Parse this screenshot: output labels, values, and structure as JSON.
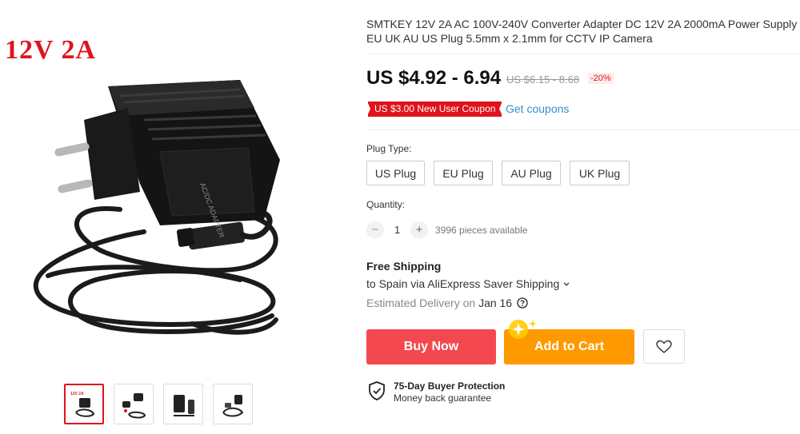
{
  "product": {
    "voltage_label": "12V 2A",
    "title": "SMTKEY 12V 2A AC 100V-240V Converter Adapter DC 12V 2A 2000mA Power Supply EU UK AU US Plug 5.5mm x 2.1mm for CCTV IP Camera"
  },
  "price": {
    "current": "US $4.92 - 6.94",
    "original": "US $6.15 - 8.68",
    "discount": "-20%"
  },
  "coupon": {
    "label": "US $3.00 New User Coupon",
    "get_link": "Get coupons"
  },
  "plug_type": {
    "label": "Plug Type:",
    "options": [
      "US Plug",
      "EU Plug",
      "AU Plug",
      "UK Plug"
    ]
  },
  "quantity": {
    "label": "Quantity:",
    "minus": "−",
    "value": "1",
    "plus": "+",
    "available": "3996 pieces available"
  },
  "shipping": {
    "title": "Free Shipping",
    "route": "to Spain via AliExpress Saver Shipping",
    "estimated_label": "Estimated Delivery on",
    "date": "Jan 16"
  },
  "actions": {
    "buy_now": "Buy Now",
    "add_to_cart": "Add to Cart"
  },
  "protection": {
    "title": "75-Day Buyer Protection",
    "subtitle": "Money back guarantee"
  },
  "colors": {
    "accent_red": "#e0131b",
    "buy_now": "#f44850",
    "add_to_cart": "#ff9900",
    "link": "#3a8dc8"
  },
  "icons": [
    "chevron-down-icon",
    "help-circle-icon",
    "heart-icon",
    "shield-check-icon",
    "sparkle-icon"
  ]
}
